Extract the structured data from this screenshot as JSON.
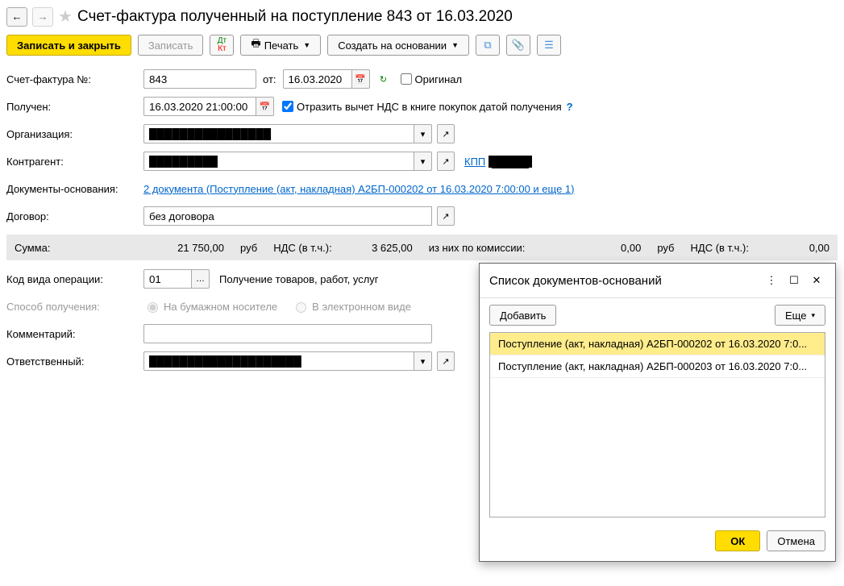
{
  "header": {
    "title": "Счет-фактура полученный на поступление 843 от 16.03.2020"
  },
  "toolbar": {
    "save_close": "Записать и закрыть",
    "save": "Записать",
    "print": "Печать",
    "create_based": "Создать на основании"
  },
  "fields": {
    "invoice_num_label": "Счет-фактура №:",
    "invoice_num": "843",
    "from_label": "от:",
    "from_date": "16.03.2020",
    "original_label": "Оригинал",
    "received_label": "Получен:",
    "received_value": "16.03.2020 21:00:00",
    "reflect_vat_label": "Отразить вычет НДС в книге покупок датой получения",
    "org_label": "Организация:",
    "org_value": "████████████████",
    "counterparty_label": "Контрагент:",
    "counterparty_value": "█████████",
    "kpp_label": "КПП",
    "kpp_value": "█████",
    "basis_docs_label": "Документы-основания:",
    "basis_docs_link": "2 документа (Поступление (акт, накладная) А2БП-000202 от 16.03.2020 7:00:00 и еще 1)",
    "contract_label": "Договор:",
    "contract_value": "без договора",
    "operation_code_label": "Код вида операции:",
    "operation_code": "01",
    "operation_code_desc": "Получение товаров, работ, услуг",
    "receive_method_label": "Способ получения:",
    "method_paper": "На бумажном носителе",
    "method_electronic": "В электронном виде",
    "comment_label": "Комментарий:",
    "comment_value": "",
    "responsible_label": "Ответственный:",
    "responsible_value": "████████████████████"
  },
  "sums": {
    "sum_label": "Сумма:",
    "sum_value": "21 750,00",
    "currency": "руб",
    "vat_label": "НДС (в т.ч.):",
    "vat_value": "3 625,00",
    "commission_label": "из них по комиссии:",
    "commission_value": "0,00",
    "commission_currency": "руб",
    "commission_vat_label": "НДС (в т.ч.):",
    "commission_vat_value": "0,00"
  },
  "popup": {
    "title": "Список документов-оснований",
    "add_btn": "Добавить",
    "more_btn": "Еще",
    "ok_btn": "ОК",
    "cancel_btn": "Отмена",
    "items": [
      "Поступление (акт, накладная) А2БП-000202 от 16.03.2020 7:0...",
      "Поступление (акт, накладная) А2БП-000203 от 16.03.2020 7:0..."
    ]
  }
}
